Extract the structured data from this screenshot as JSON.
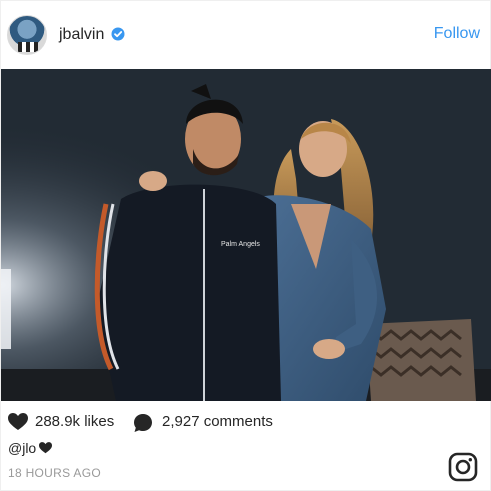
{
  "post": {
    "username": "jbalvin",
    "follow_label": "Follow",
    "likes": "288.9k likes",
    "comments": "2,927 comments",
    "caption_mention": "@jlo",
    "timestamp": "18 HOURS AGO",
    "shirt_text": "Palm Angels"
  },
  "colors": {
    "follow": "#3897f0",
    "verified": "#3897f0",
    "text": "#262626",
    "muted": "#999999"
  },
  "icons": {
    "verified": "verified-badge-icon",
    "like": "heart-icon",
    "comment": "comment-bubble-icon",
    "caption_emoji": "black-heart-icon",
    "brand": "instagram-logo-icon"
  }
}
